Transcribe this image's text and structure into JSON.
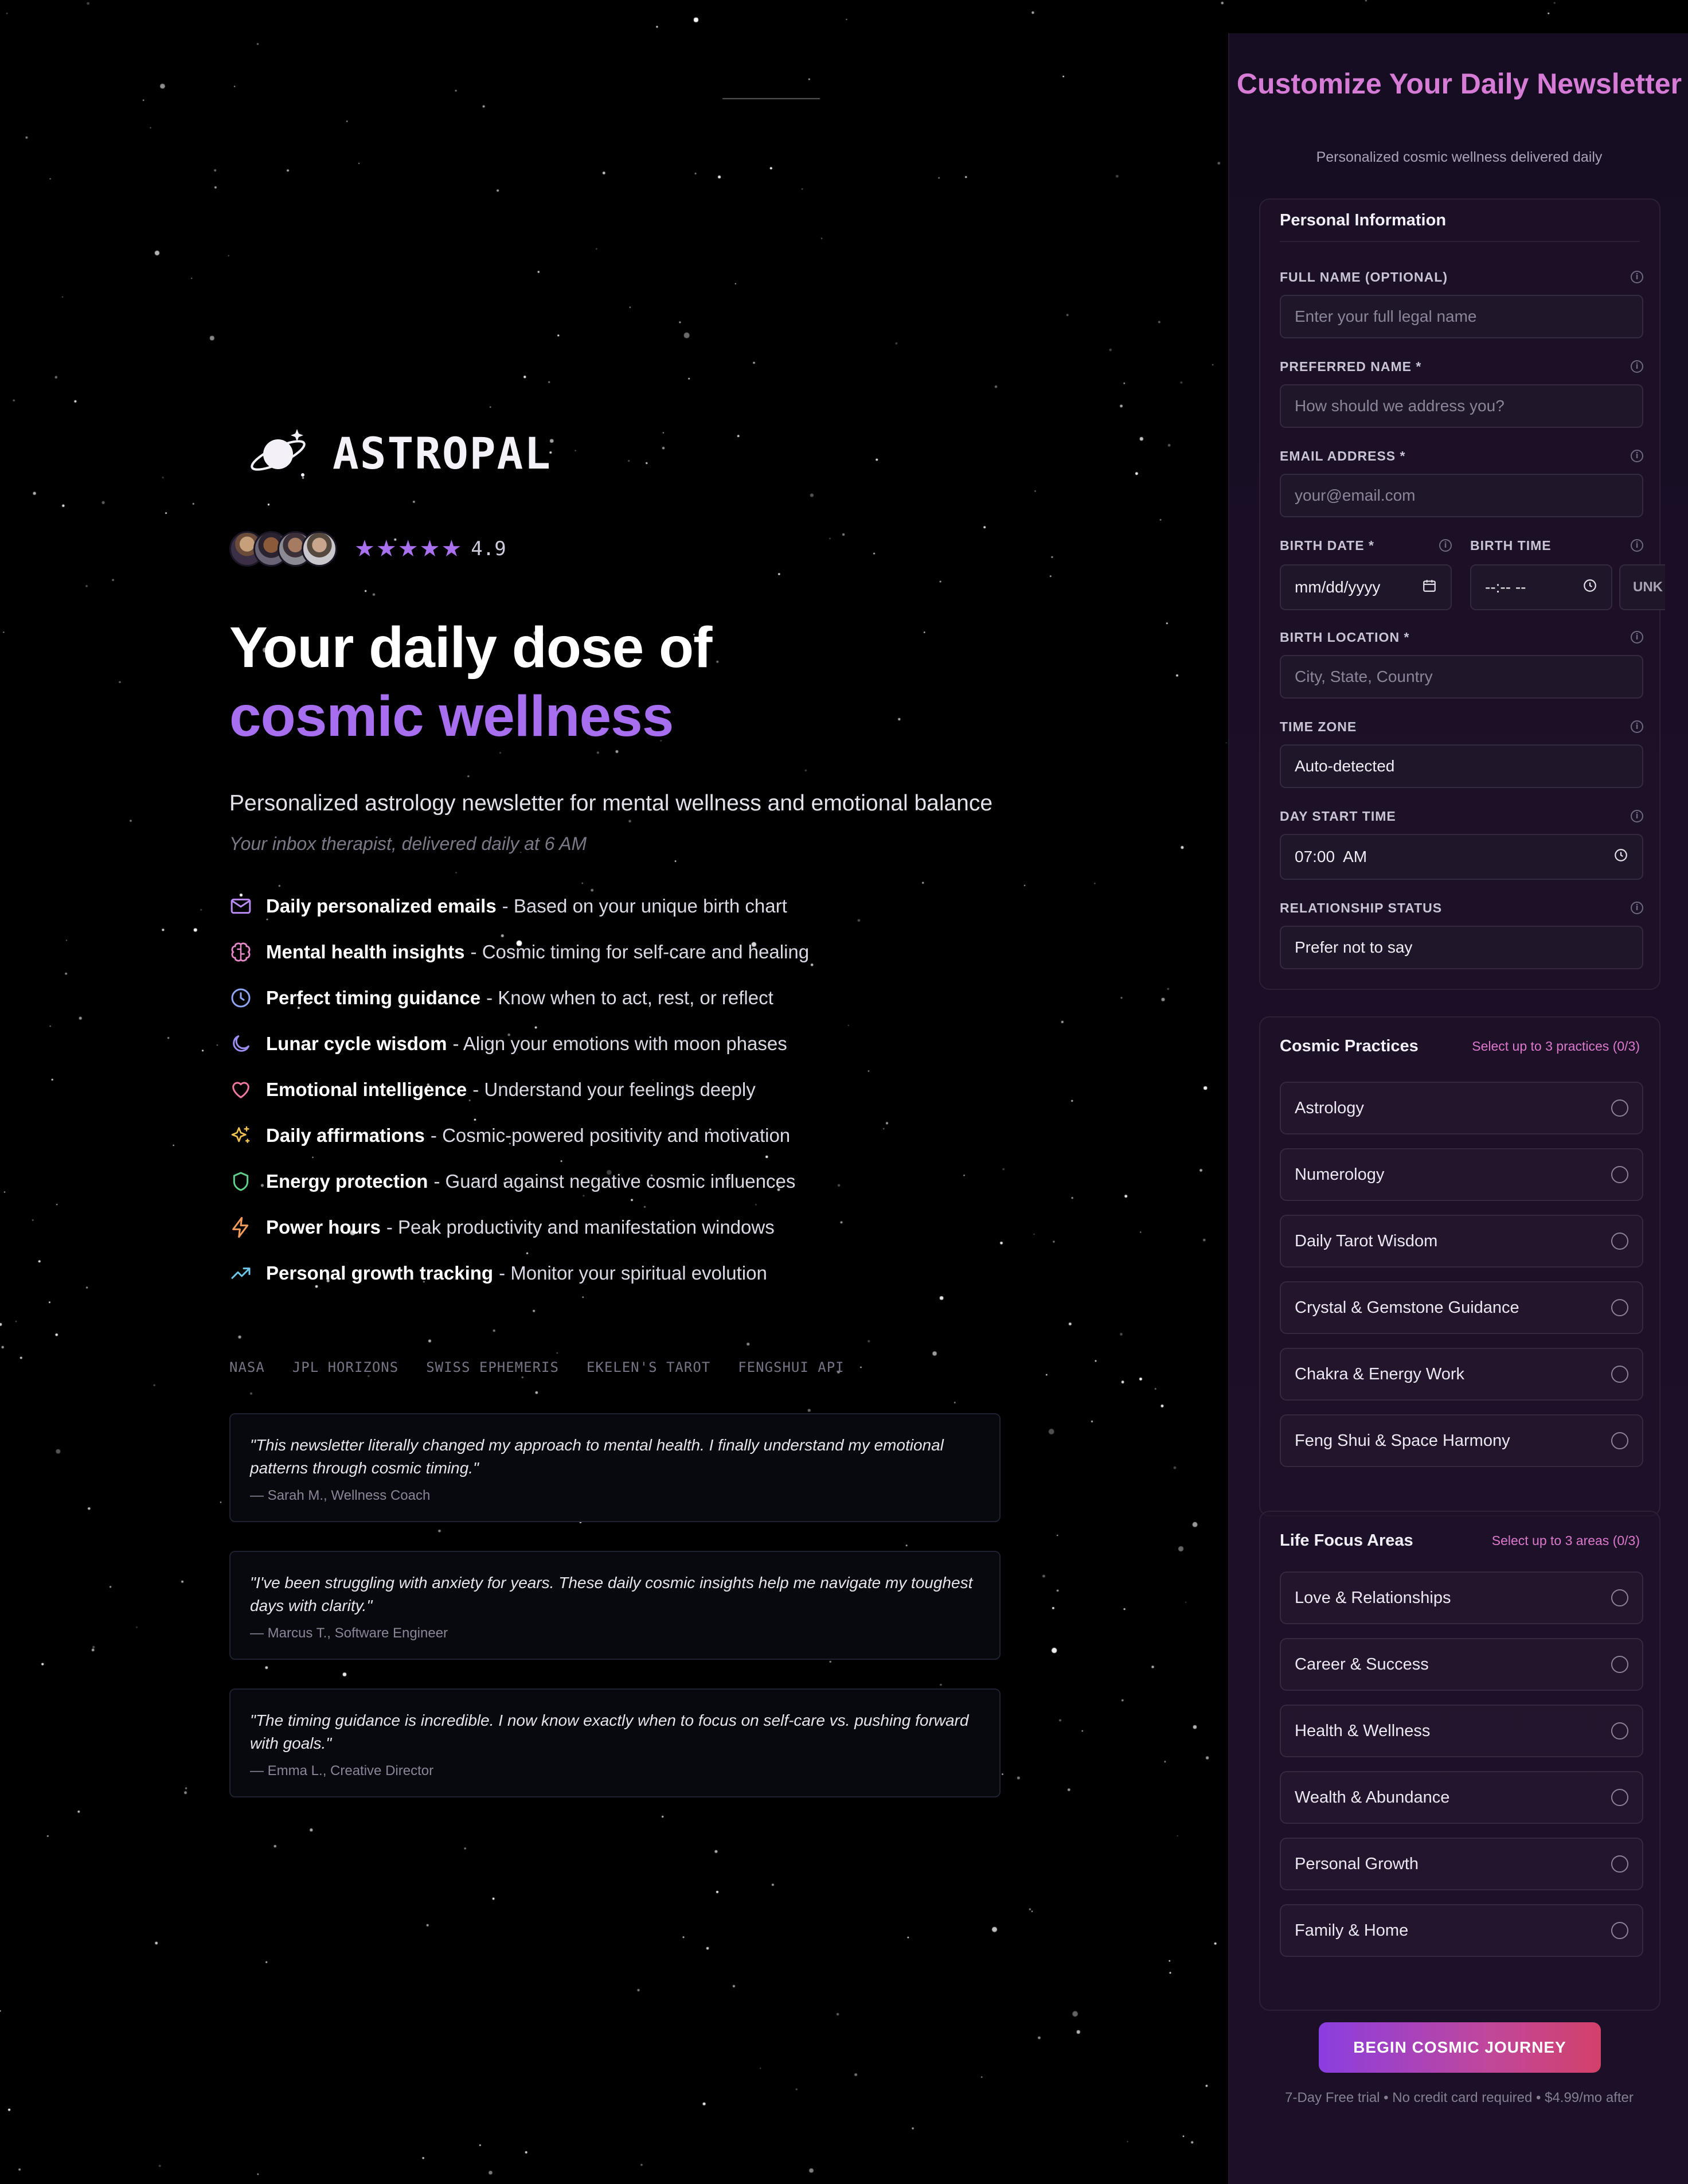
{
  "brand": {
    "name": "ASTROPAL"
  },
  "rating": {
    "stars": "★★★★★",
    "value": "4.9"
  },
  "hero": {
    "headline_line1": "Your daily dose of",
    "headline_line2": "cosmic wellness",
    "subtitle": "Personalized astrology newsletter for mental wellness and emotional balance",
    "tagline": "Your inbox therapist, delivered daily at 6 AM"
  },
  "features": [
    {
      "icon": "mail-icon",
      "title": "Daily personalized emails",
      "desc": "- Based on your unique birth chart",
      "color": "#b98cf5"
    },
    {
      "icon": "brain-icon",
      "title": "Mental health insights",
      "desc": "- Cosmic timing for self-care and healing",
      "color": "#e889c9"
    },
    {
      "icon": "clock-icon",
      "title": "Perfect timing guidance",
      "desc": "- Know when to act, rest, or reflect",
      "color": "#8fa5f5"
    },
    {
      "icon": "moon-icon",
      "title": "Lunar cycle wisdom",
      "desc": "- Align your emotions with moon phases",
      "color": "#9a8ff0"
    },
    {
      "icon": "heart-icon",
      "title": "Emotional intelligence",
      "desc": "- Understand your feelings deeply",
      "color": "#f07aa0"
    },
    {
      "icon": "sparkles-icon",
      "title": "Daily affirmations",
      "desc": "- Cosmic-powered positivity and motivation",
      "color": "#f2c14e"
    },
    {
      "icon": "shield-icon",
      "title": "Energy protection",
      "desc": "- Guard against negative cosmic influences",
      "color": "#5fd08a"
    },
    {
      "icon": "zap-icon",
      "title": "Power hours",
      "desc": "- Peak productivity and manifestation windows",
      "color": "#f39a5a"
    },
    {
      "icon": "trending-up-icon",
      "title": "Personal growth tracking",
      "desc": "- Monitor your spiritual evolution",
      "color": "#6fc6e8"
    }
  ],
  "sources": [
    "NASA",
    "JPL HORIZONS",
    "SWISS EPHEMERIS",
    "EKELEN'S TAROT",
    "FENGSHUI API"
  ],
  "testimonials": [
    {
      "quote": "\"This newsletter literally changed my approach to mental health. I finally understand my emotional patterns through cosmic timing.\"",
      "author": "— Sarah M., Wellness Coach"
    },
    {
      "quote": "\"I've been struggling with anxiety for years. These daily cosmic insights help me navigate my toughest days with clarity.\"",
      "author": "— Marcus T., Software Engineer"
    },
    {
      "quote": "\"The timing guidance is incredible. I now know exactly when to focus on self-care vs. pushing forward with goals.\"",
      "author": "— Emma L., Creative Director"
    }
  ],
  "panel": {
    "title": "Customize Your Daily Newsletter",
    "subtitle": "Personalized cosmic wellness delivered daily"
  },
  "personal": {
    "title": "Personal Information",
    "full_name": {
      "label": "FULL NAME (OPTIONAL)",
      "placeholder": "Enter your full legal name"
    },
    "preferred_name": {
      "label": "PREFERRED NAME *",
      "placeholder": "How should we address you?"
    },
    "email": {
      "label": "EMAIL ADDRESS *",
      "placeholder": "your@email.com"
    },
    "birth_date": {
      "label": "BIRTH DATE *",
      "value": "mm/dd/yyyy"
    },
    "birth_time": {
      "label": "BIRTH TIME",
      "value": "--:-- --"
    },
    "unknown_label": "UNK",
    "birth_location": {
      "label": "BIRTH LOCATION *",
      "placeholder": "City, State, Country"
    },
    "time_zone": {
      "label": "TIME ZONE",
      "value": "Auto-detected"
    },
    "day_start": {
      "label": "DAY START TIME",
      "value": "07:00  AM"
    },
    "relationship": {
      "label": "RELATIONSHIP STATUS",
      "value": "Prefer not to say"
    }
  },
  "practices": {
    "title": "Cosmic Practices",
    "hint": "Select up to 3 practices (0/3)",
    "options": [
      "Astrology",
      "Numerology",
      "Daily Tarot Wisdom",
      "Crystal & Gemstone Guidance",
      "Chakra & Energy Work",
      "Feng Shui & Space Harmony"
    ]
  },
  "focus": {
    "title": "Life Focus Areas",
    "hint": "Select up to 3 areas (0/3)",
    "options": [
      "Love & Relationships",
      "Career & Success",
      "Health & Wellness",
      "Wealth & Abundance",
      "Personal Growth",
      "Family & Home"
    ]
  },
  "cta": {
    "label": "BEGIN COSMIC JOURNEY",
    "fine_print": "7-Day Free trial • No credit card required • $4.99/mo after"
  }
}
